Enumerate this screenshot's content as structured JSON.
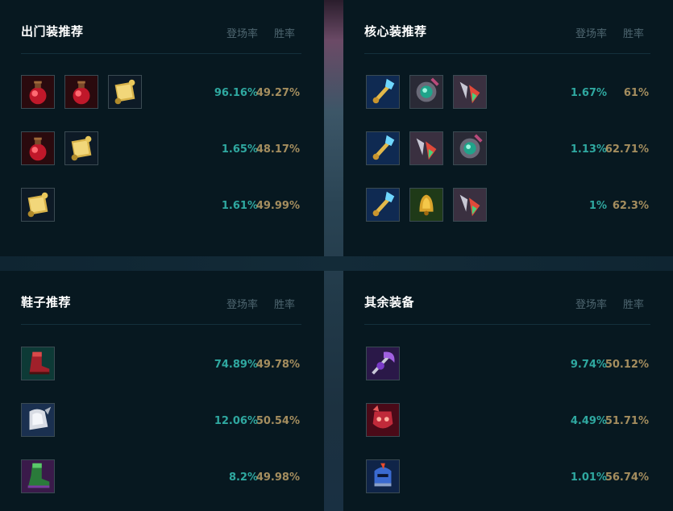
{
  "headers": {
    "pick_rate": "登场率",
    "win_rate": "胜率"
  },
  "colors": {
    "pick": "#2fa8a0",
    "win": "#a48d5e",
    "panel": "#071820"
  },
  "panels": {
    "start": {
      "title": "出门装推荐",
      "rows": [
        {
          "items": [
            "health-potion-icon",
            "health-potion-icon",
            "guardian-scroll-icon"
          ],
          "pick": "96.16%",
          "win": "49.27%"
        },
        {
          "items": [
            "health-potion-icon",
            "guardian-scroll-icon"
          ],
          "pick": "1.65%",
          "win": "48.17%"
        },
        {
          "items": [
            "guardian-scroll-icon"
          ],
          "pick": "1.61%",
          "win": "49.99%"
        }
      ]
    },
    "core": {
      "title": "核心装推荐",
      "rows": [
        {
          "items": [
            "crystal-scepter-icon",
            "emerald-orb-staff-icon",
            "prismatic-blade-icon"
          ],
          "pick": "1.67%",
          "win": "61%"
        },
        {
          "items": [
            "crystal-scepter-icon",
            "prismatic-blade-icon",
            "emerald-orb-staff-icon"
          ],
          "pick": "1.13%",
          "win": "62.71%"
        },
        {
          "items": [
            "crystal-scepter-icon",
            "golden-bell-icon",
            "prismatic-blade-icon"
          ],
          "pick": "1%",
          "win": "62.3%"
        }
      ]
    },
    "boots": {
      "title": "鞋子推荐",
      "rows": [
        {
          "items": [
            "red-boots-icon"
          ],
          "pick": "74.89%",
          "win": "49.78%"
        },
        {
          "items": [
            "white-boots-icon"
          ],
          "pick": "12.06%",
          "win": "50.54%"
        },
        {
          "items": [
            "green-boots-icon"
          ],
          "pick": "8.2%",
          "win": "49.98%"
        }
      ]
    },
    "other": {
      "title": "其余装备",
      "rows": [
        {
          "items": [
            "purple-scythe-icon"
          ],
          "pick": "9.74%",
          "win": "50.12%"
        },
        {
          "items": [
            "crimson-mask-icon"
          ],
          "pick": "4.49%",
          "win": "51.71%"
        },
        {
          "items": [
            "blue-helm-icon"
          ],
          "pick": "1.01%",
          "win": "56.74%"
        }
      ]
    }
  }
}
